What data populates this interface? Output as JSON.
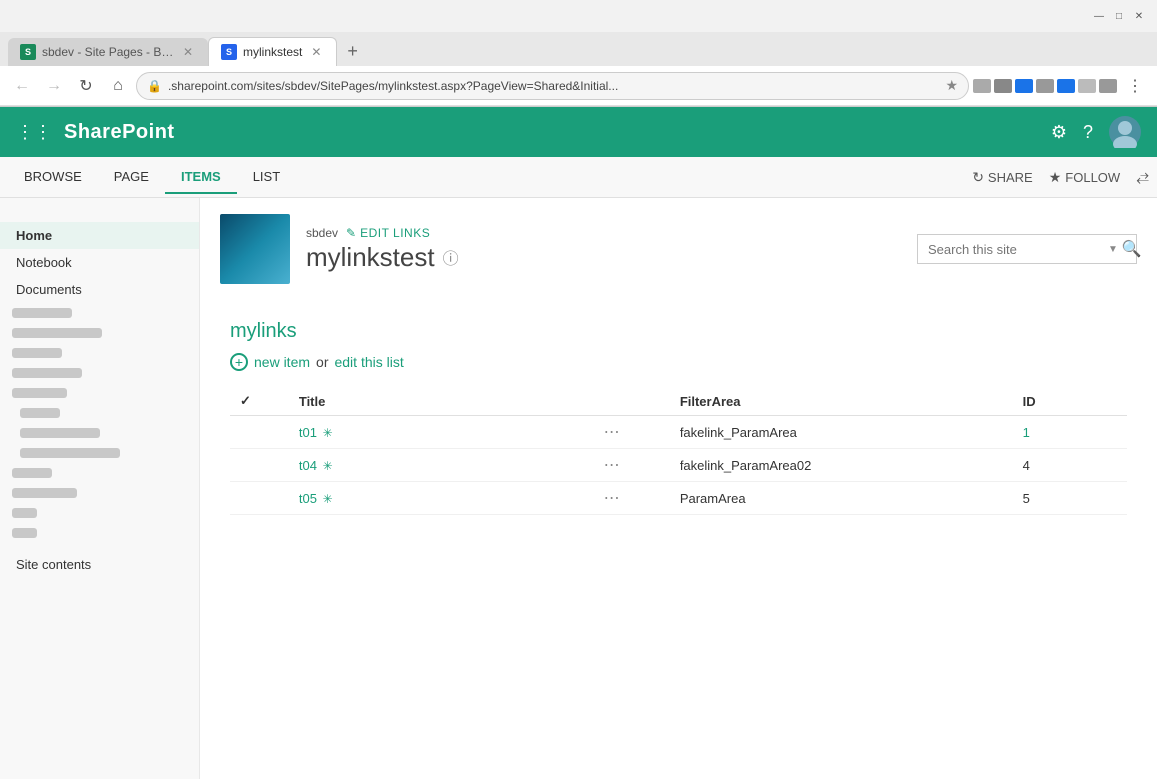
{
  "browser": {
    "tabs": [
      {
        "id": "tab1",
        "favicon_color": "green",
        "favicon_letter": "S",
        "label": "sbdev - Site Pages - By Author",
        "active": false
      },
      {
        "id": "tab2",
        "favicon_color": "blue",
        "favicon_letter": "S",
        "label": "mylinkstest",
        "active": true
      }
    ],
    "new_tab_icon": "+",
    "back_icon": "←",
    "forward_icon": "→",
    "refresh_icon": "↻",
    "home_icon": "⌂",
    "address": ".sharepoint.com/sites/sbdev/SitePages/mylinkstest.aspx?PageView=Shared&Initial...",
    "star_icon": "☆",
    "window_controls": {
      "minimize": "—",
      "maximize": "□",
      "close": "✕"
    }
  },
  "sharepoint": {
    "waffle_label": "⊞",
    "app_name": "SharePoint",
    "settings_icon": "⚙",
    "help_icon": "?",
    "avatar_initial": ""
  },
  "ribbon": {
    "tabs": [
      {
        "id": "browse",
        "label": "BROWSE",
        "active": false
      },
      {
        "id": "page",
        "label": "PAGE",
        "active": false
      },
      {
        "id": "items",
        "label": "ITEMS",
        "active": true
      },
      {
        "id": "list",
        "label": "LIST",
        "active": false
      }
    ],
    "share_label": "SHARE",
    "follow_label": "FOLLOW",
    "focus_icon": "⤢"
  },
  "site_header": {
    "owner": "sbdev",
    "edit_links_label": "EDIT LINKS",
    "page_title": "mylinkstest",
    "info_icon": "ⓘ",
    "search_placeholder": "Search this site",
    "search_icon": "🔍"
  },
  "sidebar": {
    "nav_items": [
      {
        "id": "home",
        "label": "Home",
        "active": true
      },
      {
        "id": "notebook",
        "label": "Notebook",
        "active": false
      },
      {
        "id": "documents",
        "label": "Documents",
        "active": false
      }
    ],
    "site_contents_label": "Site contents"
  },
  "list": {
    "title": "mylinks",
    "new_item_label": "new item",
    "edit_list_label": "edit this list",
    "columns": [
      {
        "id": "check",
        "label": ""
      },
      {
        "id": "title",
        "label": "Title"
      },
      {
        "id": "actions",
        "label": ""
      },
      {
        "id": "filter_area",
        "label": "FilterArea"
      },
      {
        "id": "id",
        "label": "ID"
      }
    ],
    "rows": [
      {
        "id": "row1",
        "title": "t01",
        "filter_area": "fakelink_ParamArea",
        "item_id": "1"
      },
      {
        "id": "row2",
        "title": "t04",
        "filter_area": "fakelink_ParamArea02",
        "item_id": "4"
      },
      {
        "id": "row3",
        "title": "t05",
        "filter_area": "ParamArea",
        "item_id": "5"
      }
    ]
  },
  "colors": {
    "brand": "#1a9e7a",
    "link": "#1a9e7a",
    "header_bg": "#1a9e7a"
  }
}
